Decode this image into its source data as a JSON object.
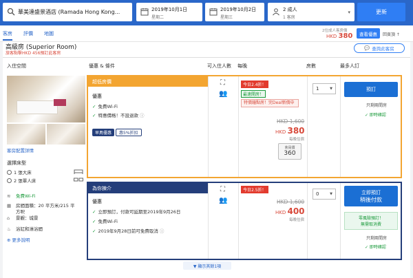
{
  "search": {
    "hotel_name": "華美達盛景酒店 (Ramada Hong Kong...",
    "checkin_date": "2019年10月1日",
    "checkin_day": "星期二",
    "checkout_date": "2019年10月2日",
    "checkout_day": "星期三",
    "guests_main": "2 成人",
    "guests_sub": "1 客房",
    "update_button": "更新"
  },
  "nav": {
    "tabs": [
      "客房",
      "評價",
      "地圖"
    ],
    "price_note": "2位成人客房價",
    "price_currency": "HKD",
    "price_value": "380",
    "view_deal_button": "查看優惠",
    "back_link": "回頁頂 ↑"
  },
  "room": {
    "title": "高級房 (Superior Room)",
    "member_note": "旅客點擊HKD 456預訂此客房",
    "ask_button": "查詢此客房",
    "gallery_link": "客房配置詳情",
    "bed_type_title": "選擇床型",
    "bed_options": [
      "1 張大床",
      "2 張單人床"
    ],
    "amenities": [
      {
        "icon": "wifi-icon",
        "glyph": "≋",
        "text": "免費Wi-Fi",
        "color": "#1a9a3b"
      },
      {
        "icon": "area-icon",
        "glyph": "▦",
        "text": "房間面積：20 平方米/215 平",
        "color": "#333333"
      },
      {
        "icon": "",
        "glyph": "",
        "text": "方呎",
        "color": "#333333"
      },
      {
        "icon": "view-icon",
        "glyph": "⌂",
        "text": "景觀：城景",
        "color": "#333333"
      },
      {
        "icon": "shower-icon",
        "glyph": "♨",
        "text": "浴缸和淋浴間",
        "color": "#333333"
      }
    ],
    "more_info": "更多說明"
  },
  "columns": {
    "room_type": "入住空間",
    "conditions": "優惠 & 條件",
    "capacity": "可入住人數",
    "price": "每晚",
    "quantity": "房數",
    "book": "最多人訂"
  },
  "offers": [
    {
      "band": "超低房價",
      "band_color": "#f3a531",
      "cond_title": "優惠",
      "conditions": [
        "免費Wi-Fi",
        "特惠價格！不設退款"
      ],
      "promo_label": "早鳥優惠",
      "promo_value": "惠5%折扣",
      "deal_badge": "今日2.4折！",
      "green_tag": "最速開房！",
      "red_box_text": "特價鐘點房！完Deal新價中",
      "original_price": "HKD 1,600",
      "currency": "HKD",
      "price": "380",
      "tax_note": "每晚住宿",
      "member_label": "會員價",
      "member_price": "360",
      "quantity": "1",
      "book_button": "預訂",
      "book_sub": "",
      "only_left": "只剩兩間房",
      "instant": "✓ 即時確認",
      "green_box_1": "",
      "green_box_2": ""
    },
    {
      "band": "為你揀介",
      "band_color": "#243e7a",
      "cond_title": "優惠",
      "conditions": [
        "立即預訂，付款可延期至2019年9月26日",
        "免費Wi-Fi",
        "2019年9月28日前可免費取消"
      ],
      "promo_label": "",
      "promo_value": "",
      "deal_badge": "今日2.5折！",
      "green_tag": "",
      "red_box_text": "",
      "original_price": "HKD 1,600",
      "currency": "HKD",
      "price": "400",
      "tax_note": "每晚住宿",
      "member_label": "",
      "member_price": "",
      "quantity": "0",
      "book_button": "立即預訂",
      "book_sub": "稍後付款",
      "only_left": "只剩兩間房",
      "instant": "✓ 即時確認",
      "green_box_1": "零風險預訂！",
      "green_box_2": "無需取消費"
    }
  ],
  "more_rooms": "▼ 顯示其餘1項"
}
